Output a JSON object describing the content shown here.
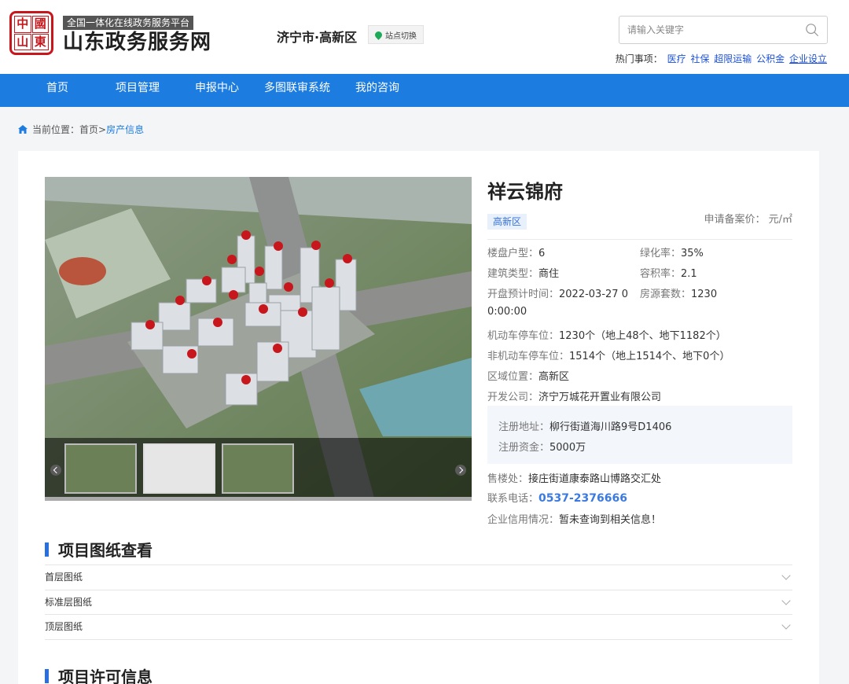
{
  "header": {
    "seal_chars": [
      "中",
      "國",
      "山",
      "東"
    ],
    "tagline": "全国一体化在线政务服务平台",
    "site_title": "山东政务服务网",
    "city": "济宁市·高新区",
    "switch_label": "站点切换",
    "search_placeholder": "请输入关键字",
    "hot_label": "热门事项：",
    "hot_items": [
      "医疗",
      "社保",
      "超限运输",
      "公积金",
      "企业设立"
    ]
  },
  "nav": {
    "items": [
      "首页",
      "项目管理",
      "申报中心",
      "多图联审系统",
      "我的咨询"
    ]
  },
  "breadcrumb": {
    "prefix": "当前位置：",
    "home": "首页",
    "sep": ">",
    "current": "房产信息"
  },
  "property": {
    "name": "祥云锦府",
    "district_tag": "高新区",
    "price_label": "申请备案价：",
    "price_unit": "元/㎡",
    "info": {
      "unit_type_label": "楼盘户型：",
      "unit_type": "6",
      "green_rate_label": "绿化率：",
      "green_rate": "35%",
      "building_type_label": "建筑类型：",
      "building_type": "商住",
      "plot_ratio_label": "容积率：",
      "plot_ratio": "2.1",
      "open_time_label": "开盘预计时间：",
      "open_time_1": "2022-03-27 0",
      "open_time_2": "0:00:00",
      "housing_count_label": "房源套数：",
      "housing_count": "1230",
      "motor_parking_label": "机动车停车位：",
      "motor_parking": "1230个（地上48个、地下1182个）",
      "nonmotor_parking_label": "非机动车停车位：",
      "nonmotor_parking": "1514个（地上1514个、地下0个）",
      "location_label": "区域位置：",
      "location": "高新区",
      "developer_label": "开发公司：",
      "developer": "济宁万城花开置业有限公司",
      "reg_address_label": "注册地址：",
      "reg_address": "柳行街道海川路9号D1406",
      "reg_capital_label": "注册资金：",
      "reg_capital": "5000万",
      "sales_office_label": "售楼处：",
      "sales_office": "接庄街道康泰路山博路交汇处",
      "phone_label": "联系电话：",
      "phone": "0537-2376666",
      "credit_label": "企业信用情况：",
      "credit": "暂未查询到相关信息！"
    }
  },
  "sections": {
    "drawings_title": "项目图纸查看",
    "drawings": [
      "首层图纸",
      "标准层图纸",
      "顶层图纸"
    ],
    "license_title": "项目许可信息"
  },
  "colors": {
    "nav_blue": "#1d7ce0",
    "seal_red": "#c8161d",
    "phone_blue": "#3b7ae0"
  }
}
